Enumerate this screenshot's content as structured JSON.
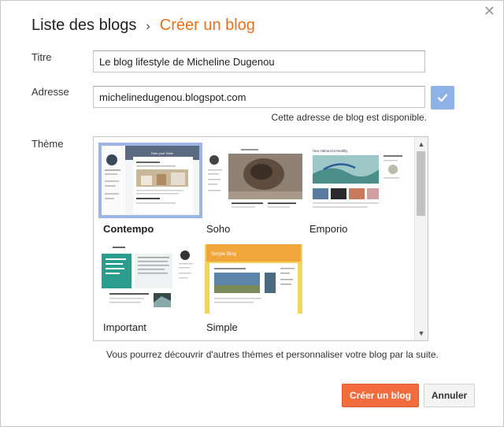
{
  "dialog": {
    "close_icon": "close-icon",
    "breadcrumb": {
      "parent": "Liste des blogs",
      "separator": "›",
      "current": "Créer un blog"
    }
  },
  "form": {
    "title_label": "Titre",
    "title_value": "Le blog lifestyle de Micheline Dugenou",
    "address_label": "Adresse",
    "address_value": "michelinedugenou.blogspot.com",
    "address_status_icon": "checkmark-icon",
    "address_hint": "Cette adresse de blog est disponible.",
    "theme_label": "Thème"
  },
  "themes": [
    {
      "name": "Contempo",
      "selected": true,
      "preview_header": "Rate your Table"
    },
    {
      "name": "Soho",
      "selected": false
    },
    {
      "name": "Emporio",
      "selected": false,
      "preview_header": "How Yalma Got Healthy"
    },
    {
      "name": "Important",
      "selected": false
    },
    {
      "name": "Simple",
      "selected": false,
      "preview_header": "Simple Blog"
    }
  ],
  "themes_footnote": "Vous pourrez découvrir d'autres thèmes et personnaliser votre blog par la suite.",
  "actions": {
    "create": "Créer un blog",
    "cancel": "Annuler"
  },
  "colors": {
    "accent": "#e8701a",
    "primary_button": "#f36c3d",
    "check_bg": "#8eb1e8",
    "selected_outline": "#9cb5e2"
  }
}
